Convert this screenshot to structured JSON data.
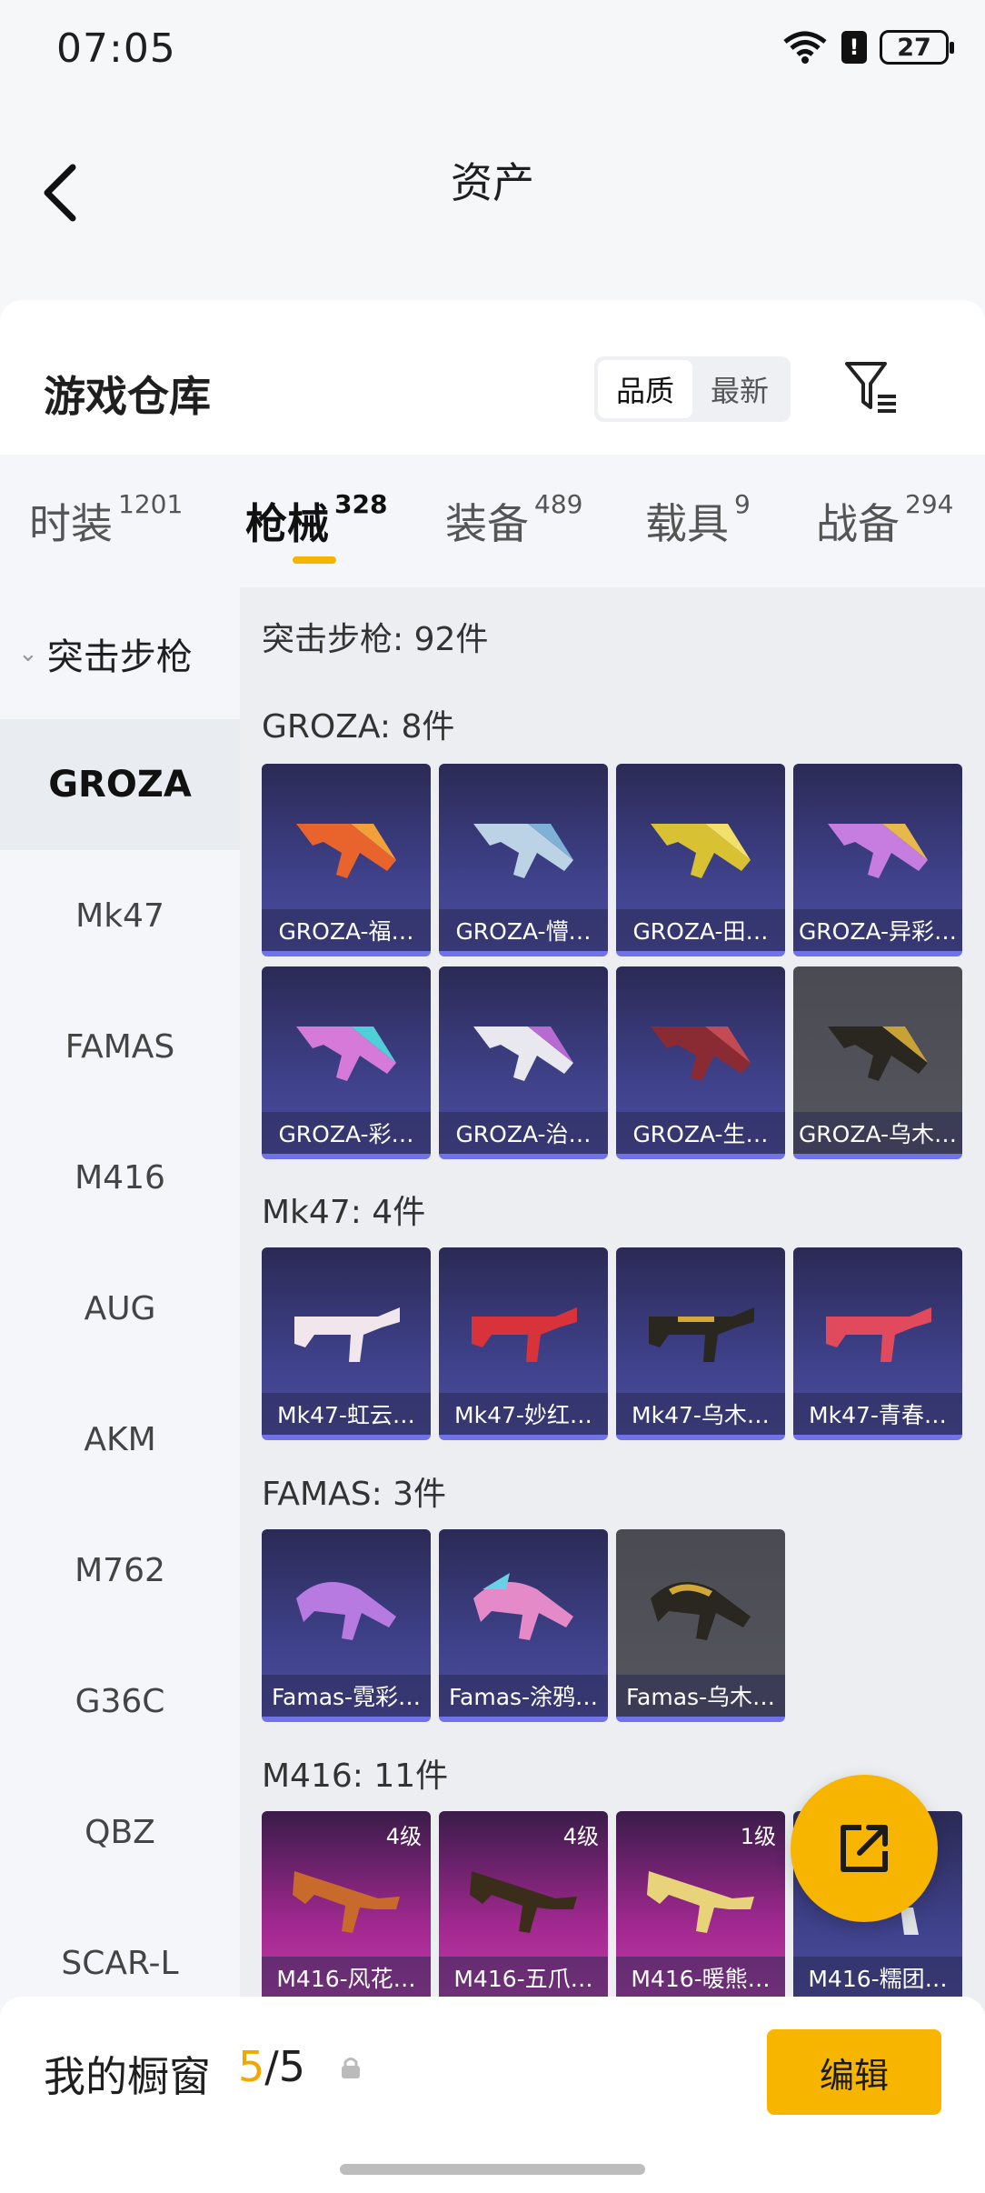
{
  "status_bar": {
    "time": "07:05",
    "battery": "27",
    "alert": "!"
  },
  "nav": {
    "title": "资产"
  },
  "header": {
    "title": "游戏仓库",
    "seg_quality": "品质",
    "seg_latest": "最新"
  },
  "tabs": [
    {
      "label": "时装",
      "count": "1201"
    },
    {
      "label": "枪械",
      "count": "328"
    },
    {
      "label": "装备",
      "count": "489"
    },
    {
      "label": "载具",
      "count": "9"
    },
    {
      "label": "战备",
      "count": "294"
    }
  ],
  "sidebar": {
    "category": "突击步枪",
    "items": [
      "GROZA",
      "Mk47",
      "FAMAS",
      "M416",
      "AUG",
      "AKM",
      "M762",
      "G36C",
      "QBZ",
      "SCAR-L"
    ]
  },
  "main": {
    "total": "突击步枪: 92件",
    "groups": [
      {
        "title": "GROZA: 8件",
        "items": [
          "GROZA-福…",
          "GROZA-懵…",
          "GROZA-田…",
          "GROZA-异彩…",
          "GROZA-彩…",
          "GROZA-治…",
          "GROZA-生…",
          "GROZA-乌木…"
        ]
      },
      {
        "title": "Mk47: 4件",
        "items": [
          "Mk47-虹云…",
          "Mk47-妙红…",
          "Mk47-乌木…",
          "Mk47-青春…"
        ]
      },
      {
        "title": "FAMAS: 3件",
        "items": [
          "Famas-霓彩…",
          "Famas-涂鸦…",
          "Famas-乌木…"
        ]
      },
      {
        "title": "M416: 11件",
        "items": [
          {
            "label": "M416-风花…",
            "level": "4级"
          },
          {
            "label": "M416-五爪…",
            "level": "4级"
          },
          {
            "label": "M416-暖熊…",
            "level": "1级"
          },
          {
            "label": "M416-糯团…",
            "level": ""
          }
        ]
      }
    ]
  },
  "bottom": {
    "label": "我的橱窗",
    "current": "5",
    "total": "/5",
    "edit": "编辑"
  },
  "icons": [
    "back-arrow-icon",
    "filter-icon",
    "wifi-icon",
    "lock-icon",
    "share-icon",
    "chevron-down-icon",
    "gun-icon"
  ],
  "colors": {
    "accent": "#f7b500",
    "card_purple": "#3d3f86",
    "card_pink": "#c43aa7"
  }
}
